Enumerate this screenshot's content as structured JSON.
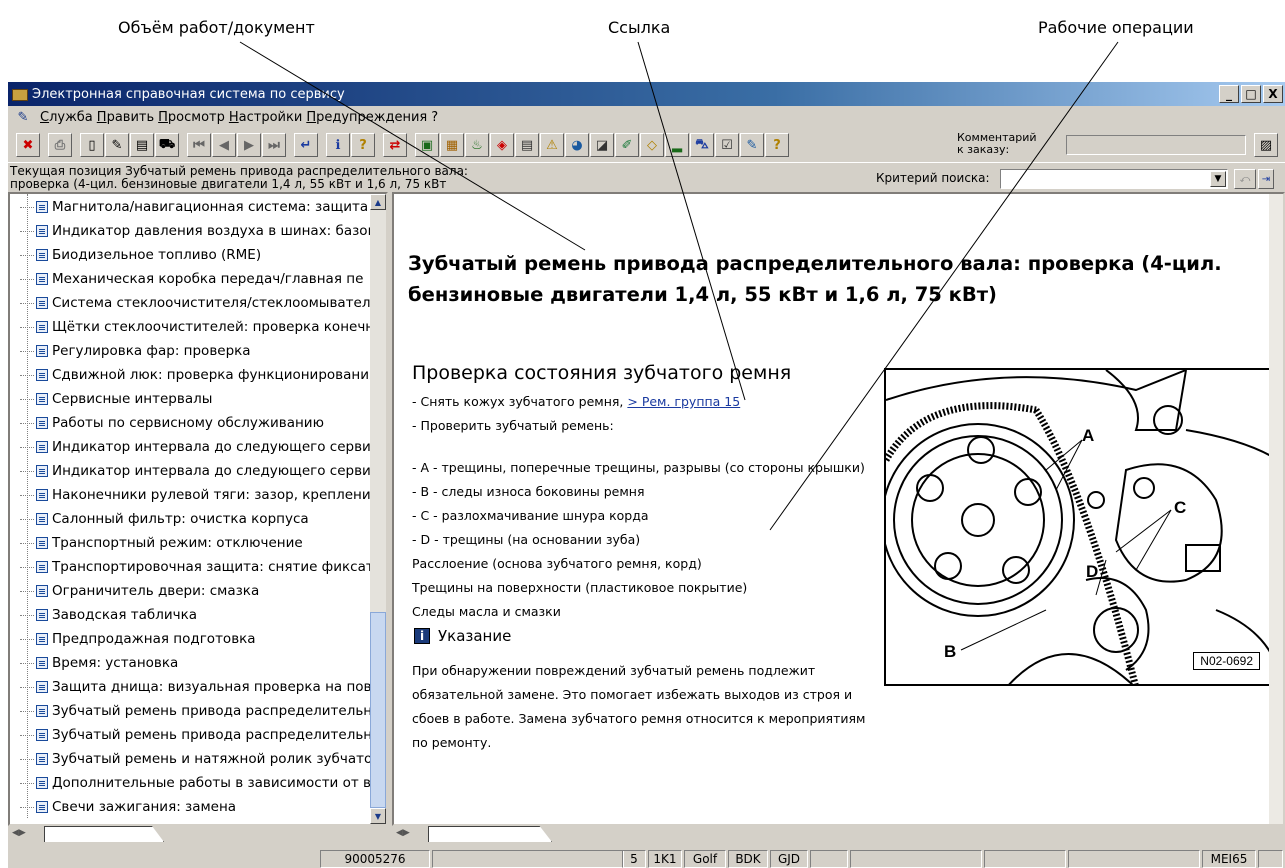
{
  "callouts": {
    "scope": "Объём работ/документ",
    "link": "Ссылка",
    "operations": "Рабочие операции"
  },
  "window": {
    "title": "Электронная справочная система по сервису",
    "minimize": "_",
    "maximize": "□",
    "close": "X"
  },
  "menu": {
    "items": [
      "Служба",
      "Править",
      "Просмотр",
      "Настройки",
      "Предупреждения",
      "?"
    ]
  },
  "toolbar": {
    "comment_label_line1": "Комментарий",
    "comment_label_line2": "к заказу:",
    "comment_value": ""
  },
  "position": {
    "text": "Текущая позиция Зубчатый ремень привода распределительного вала: проверка (4-цил. бензиновые двигатели 1,4 л, 55 кВт и 1,6 л, 75 кВт",
    "criteria_label": "Критерий поиска:",
    "criteria_value": ""
  },
  "tree": {
    "items": [
      "Магнитола/навигационная система: защита",
      "Индикатор давления воздуха в шинах: базов",
      "Биодизельное топливо (RME)",
      "Механическая коробка передач/главная пе",
      "Система стеклоочистителя/стеклоомывателя",
      "Щётки стеклоочистителей: проверка конечн",
      "Регулировка фар: проверка",
      "Сдвижной люк: проверка функционирования",
      "Сервисные интервалы",
      "Работы по сервисному обслуживанию",
      "Индикатор интервала до следующего сервис",
      "Индикатор интервала до следующего сервис",
      "Наконечники рулевой тяги: зазор, крепление",
      "Салонный фильтр: очистка корпуса",
      "Транспортный режим: отключение",
      "Транспортировочная защита: снятие фиксато",
      "Ограничитель двери: смазка",
      "Заводская табличка",
      "Предпродажная подготовка",
      "Время: установка",
      "Защита днища: визуальная проверка на повр",
      "Зубчатый ремень привода распределительно",
      "Зубчатый ремень привода распределительно",
      "Зубчатый ремень и натяжной ролик зубчатог",
      "Дополнительные работы в зависимости от вр",
      "Свечи зажигания: замена"
    ]
  },
  "document": {
    "title": "Зубчатый ремень привода распределительного вала: проверка (4-цил. бензиновые двигатели 1,4 л, 55 кВт и 1,6 л, 75 кВт)",
    "section": "Проверка состояния зубчатого ремня",
    "step1_prefix": "- Снять кожух зубчатого ремня, ",
    "step1_link": "> Рем. группа 15",
    "step2": "- Проверить зубчатый ремень:",
    "checks": [
      "- A - трещины, поперечные трещины, разрывы (со стороны крышки)",
      "- B - следы износа боковины ремня",
      "- C - разлохмачивание шнура корда",
      "- D - трещины (на основании зуба)",
      "Расслоение (основа зубчатого ремня, корд)",
      "Трещины на поверхности (пластиковое покрытие)",
      "Следы масла и смазки"
    ],
    "note_title": "Указание",
    "note_text": "При обнаружении повреждений зубчатый ремень подлежит обязательной замене. Это помогает избежать выходов из строя и сбоев в работе. Замена зубчатого ремня относится к мероприятиям по ремонту.",
    "figure": {
      "label_a": "A",
      "label_b": "B",
      "label_c": "C",
      "label_d": "D",
      "code": "N02-0692"
    }
  },
  "status": {
    "order": "90005276",
    "c1": "5",
    "c2": "1K1",
    "c3": "Golf",
    "c4": "BDK",
    "c5": "GJD",
    "c6": "MEI65"
  }
}
